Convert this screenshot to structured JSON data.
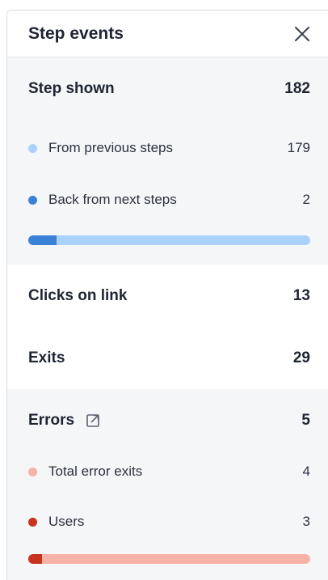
{
  "header": {
    "title": "Step events",
    "close_icon": "close-icon"
  },
  "step_shown": {
    "label": "Step shown",
    "value": "182",
    "items": [
      {
        "label": "From previous steps",
        "value": "179",
        "color": "#a9d1fb"
      },
      {
        "label": "Back from next steps",
        "value": "2",
        "color": "#3b82d6"
      }
    ],
    "bar": {
      "primary_color": "#3b82d6",
      "secondary_color": "#a9d1fb",
      "primary_fraction": 0.1
    }
  },
  "clicks": {
    "label": "Clicks on link",
    "value": "13"
  },
  "exits": {
    "label": "Exits",
    "value": "29"
  },
  "errors": {
    "label": "Errors",
    "value": "5",
    "link_icon": "external-link-icon",
    "items": [
      {
        "label": "Total error exits",
        "value": "4",
        "color": "#f7b2a8"
      },
      {
        "label": "Users",
        "value": "3",
        "color": "#c8321e"
      }
    ],
    "bar": {
      "primary_color": "#c8321e",
      "secondary_color": "#f7b2a8",
      "primary_fraction": 0.05
    }
  }
}
